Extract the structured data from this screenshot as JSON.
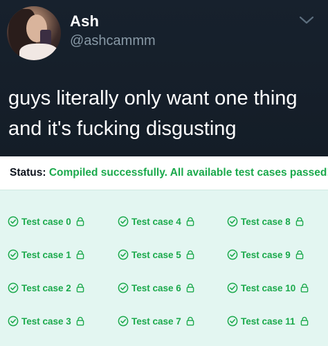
{
  "tweet": {
    "display_name": "Ash",
    "handle": "@ashcammm",
    "text_lines": [
      "guys literally only want one thing",
      "and it's fucking disgusting"
    ],
    "colors": {
      "background": "#15202b",
      "text": "#ffffff",
      "handle": "#8899a6"
    }
  },
  "status": {
    "label": "Status:",
    "message": "Compiled successfully. All available test cases passed!",
    "colors": {
      "label": "#0e141e",
      "message": "#1ba94c"
    }
  },
  "test_cases": [
    {
      "label": "Test case 0",
      "status": "passed",
      "icon": "check-circle-icon",
      "locked": true
    },
    {
      "label": "Test case 1",
      "status": "passed",
      "icon": "check-circle-icon",
      "locked": true
    },
    {
      "label": "Test case 2",
      "status": "passed",
      "icon": "check-circle-icon",
      "locked": true
    },
    {
      "label": "Test case 3",
      "status": "passed",
      "icon": "check-circle-icon",
      "locked": true
    },
    {
      "label": "Test case 4",
      "status": "passed",
      "icon": "check-circle-icon",
      "locked": true
    },
    {
      "label": "Test case 5",
      "status": "passed",
      "icon": "check-circle-icon",
      "locked": true
    },
    {
      "label": "Test case 6",
      "status": "passed",
      "icon": "check-circle-icon",
      "locked": true
    },
    {
      "label": "Test case 7",
      "status": "passed",
      "icon": "check-circle-icon",
      "locked": true
    },
    {
      "label": "Test case 8",
      "status": "passed",
      "icon": "check-circle-icon",
      "locked": true
    },
    {
      "label": "Test case 9",
      "status": "passed",
      "icon": "check-circle-icon",
      "locked": true
    },
    {
      "label": "Test case 10",
      "status": "passed",
      "icon": "check-circle-icon",
      "locked": true
    },
    {
      "label": "Test case 11",
      "status": "passed",
      "icon": "check-circle-icon",
      "locked": true
    }
  ],
  "colors": {
    "cases_background": "#e3f6f1",
    "success": "#1ba94c"
  }
}
